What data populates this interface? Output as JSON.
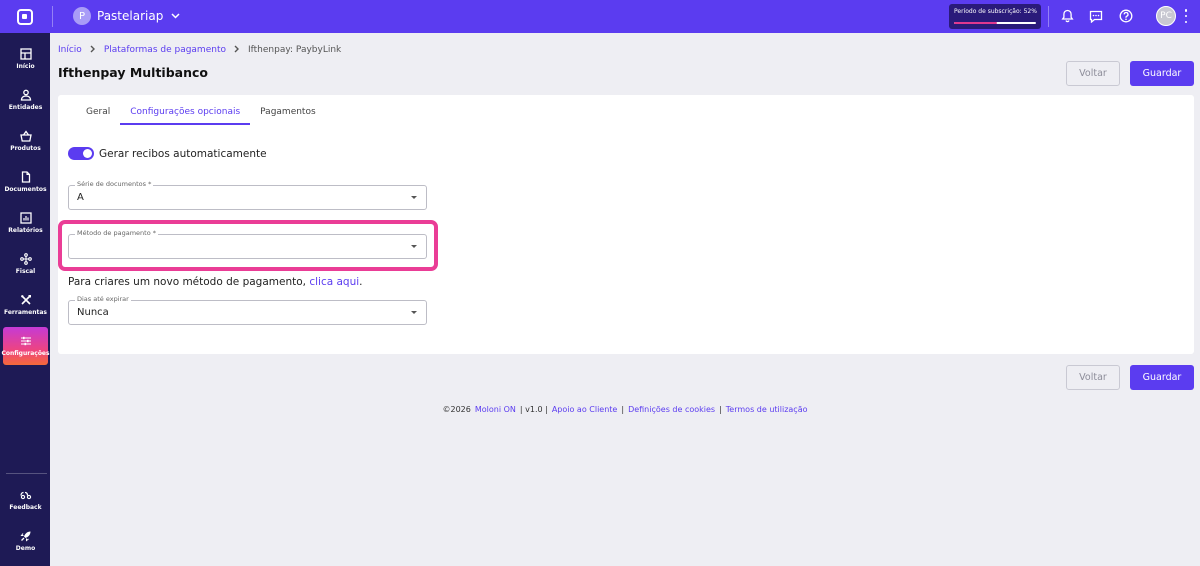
{
  "topbar": {
    "company_initial": "P",
    "company_name": "Pastelariap",
    "subscription_label": "Período de subscrição: 52%",
    "subscription_progress": 0.52,
    "user_initials": "PC"
  },
  "sidebar": {
    "items": [
      {
        "label": "Início",
        "icon": "dashboard-icon"
      },
      {
        "label": "Entidades",
        "icon": "person-icon"
      },
      {
        "label": "Produtos",
        "icon": "basket-icon"
      },
      {
        "label": "Documentos",
        "icon": "document-icon"
      },
      {
        "label": "Relatórios",
        "icon": "chart-icon"
      },
      {
        "label": "Fiscal",
        "icon": "network-icon"
      },
      {
        "label": "Ferramentas",
        "icon": "tools-icon"
      },
      {
        "label": "Configurações",
        "icon": "sliders-icon"
      }
    ],
    "bottom_items": [
      {
        "label": "Feedback",
        "icon": "feedback-icon"
      },
      {
        "label": "Demo",
        "icon": "rocket-icon"
      }
    ],
    "active_color": "#f0457a"
  },
  "breadcrumb": {
    "home": "Início",
    "parent": "Plataformas de pagamento",
    "current": "Ifthenpay: PaybyLink"
  },
  "page": {
    "title": "Ifthenpay Multibanco",
    "back_label": "Voltar",
    "save_label": "Guardar"
  },
  "tabs": [
    "Geral",
    "Configurações opcionais",
    "Pagamentos"
  ],
  "form": {
    "toggle_label": "Gerar recibos automaticamente",
    "toggle_on": true,
    "series_label": "Série de documentos *",
    "series_value": "A",
    "payment_method_label": "Método de pagamento *",
    "payment_method_value": "",
    "help_text": "Para criares um novo método de pagamento,",
    "help_link": "clica aqui",
    "help_end": ".",
    "expire_label": "Dias até expirar",
    "expire_value": "Nunca"
  },
  "footer": {
    "copyright": "©2026",
    "brand": "Moloni ON",
    "version": "| v1.0 |",
    "support": "Apoio ao Cliente",
    "sep1": "|",
    "cookies": "Definições de cookies",
    "sep2": "|",
    "terms": "Termos de utilização"
  },
  "colors": {
    "brand": "#5b3cf0",
    "sidebar": "#1e1a55",
    "highlight": "#ea3d96"
  }
}
